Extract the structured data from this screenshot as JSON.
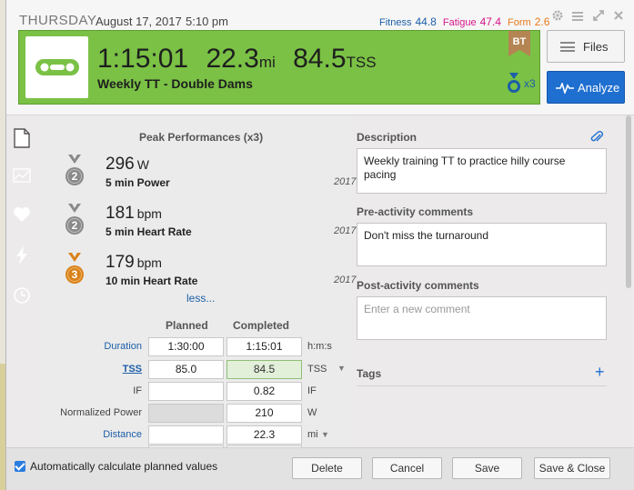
{
  "header": {
    "day": "THURSDAY",
    "date": "August 17, 2017",
    "time": "5:10 pm",
    "fitness_label": "Fitness",
    "fitness_value": "44.8",
    "fatigue_label": "Fatigue",
    "fatigue_value": "47.4",
    "form_label": "Form",
    "form_value": "2.6",
    "icons": [
      "gear-icon",
      "menu-icon",
      "expand-icon",
      "close-icon"
    ]
  },
  "summary": {
    "duration": "1:15:01",
    "distance": "22.3",
    "distance_unit": "mi",
    "tss": "84.5",
    "tss_unit": "TSS",
    "title": "Weekly TT - Double Dams",
    "sport_icon": "bike-icon",
    "badge": "BT",
    "medal_count": "x3",
    "bar_color": "#7ac145"
  },
  "buttons": {
    "files": "Files",
    "analyze": "Analyze"
  },
  "peak": {
    "title": "Peak Performances (x3)",
    "items": [
      {
        "rank": "2",
        "value": "296",
        "unit": "W",
        "label": "5 min Power",
        "year": "2017",
        "medal": "silver"
      },
      {
        "rank": "2",
        "value": "181",
        "unit": "bpm",
        "label": "5 min Heart Rate",
        "year": "2017",
        "medal": "silver"
      },
      {
        "rank": "3",
        "value": "179",
        "unit": "bpm",
        "label": "10 min Heart Rate",
        "year": "2017",
        "medal": "bronze"
      }
    ],
    "less": "less..."
  },
  "table": {
    "planned_head": "Planned",
    "completed_head": "Completed",
    "rows": [
      {
        "label": "Duration",
        "planned": "1:30:00",
        "completed": "1:15:01",
        "unit": "h:m:s"
      },
      {
        "label": "TSS",
        "planned": "85.0",
        "completed": "84.5",
        "unit": "TSS"
      },
      {
        "label": "IF",
        "planned": "",
        "completed": "0.82",
        "unit": "IF"
      },
      {
        "label": "Normalized Power",
        "planned": "",
        "completed": "210",
        "unit": "W"
      },
      {
        "label": "Distance",
        "planned": "",
        "completed": "22.3",
        "unit": "mi"
      }
    ]
  },
  "right": {
    "description_title": "Description",
    "description": "Weekly training TT to practice hilly course pacing",
    "pre_title": "Pre-activity comments",
    "pre_text": "Don't miss the turnaround",
    "post_title": "Post-activity comments",
    "post_placeholder": "Enter a new comment",
    "tags_title": "Tags"
  },
  "footer": {
    "auto_label": "Automatically calculate planned values",
    "delete": "Delete",
    "cancel": "Cancel",
    "save": "Save",
    "save_close": "Save & Close"
  }
}
